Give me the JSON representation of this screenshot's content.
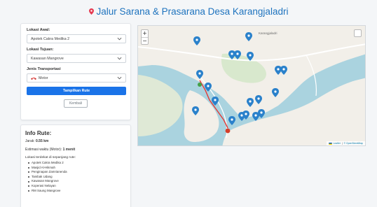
{
  "header": {
    "title": "Jalur Sarana & Prasarana Desa Karangjaladri"
  },
  "form": {
    "origin_label": "Lokasi Awal:",
    "origin_value": "Apotek Cakra Medika 2",
    "destination_label": "Lokasi Tujuan:",
    "destination_value": "Kawasan Mangrove",
    "transport_label": "Jenis Transportasi",
    "transport_value": "Motor",
    "show_route_label": "Tampilkan Rute",
    "back_label": "Kembali"
  },
  "info": {
    "title": "Info Rute:",
    "distance_label": "Jarak:",
    "distance_value": "0.55 km",
    "time_label": "Estimasi waktu (Motor):",
    "time_value": "1 menit",
    "nearby_label": "Lokasi terdekat di sepanjang rute:",
    "nearby": [
      "Apotek Cakra Medika 2",
      "Masjid Al-Hikmah",
      "Penginapan Zamrianenda",
      "Tambak Udang",
      "Kawasan Mangrove",
      "Koperasi Nelayan",
      "RM Saung Mangrove"
    ]
  },
  "map": {
    "zoom_in": "+",
    "zoom_out": "−",
    "village_label": "Karangjaladri",
    "attribution_leaflet": "Leaflet",
    "attribution_sep": "|",
    "attribution_osm": "© OpenStreetMap",
    "colors": {
      "water": "#aad3df",
      "land": "#f2efe9",
      "marker": "#2a81cb",
      "route": "#e53935",
      "origin": "#43a047",
      "destination": "#d63e2a"
    }
  },
  "icons": {
    "header": "map-pin-icon",
    "transport": "motorcycle-icon",
    "select_arrow": "chevron-down-icon"
  }
}
